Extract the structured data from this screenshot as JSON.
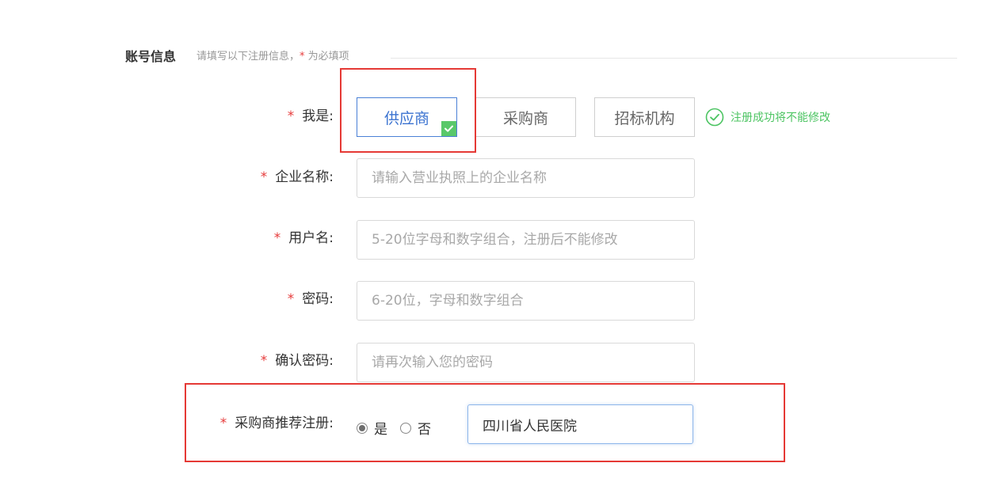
{
  "section": {
    "title": "账号信息",
    "hint_prefix": "请填写以下注册信息，",
    "hint_star": "*",
    "hint_suffix": " 为必填项"
  },
  "required_mark": "*",
  "role": {
    "label": "我是:",
    "options": [
      "供应商",
      "采购商",
      "招标机构"
    ],
    "selected": "供应商",
    "notice": "注册成功将不能修改"
  },
  "company": {
    "label": "企业名称:",
    "placeholder": "请输入营业执照上的企业名称",
    "value": ""
  },
  "username": {
    "label": "用户名:",
    "placeholder": "5-20位字母和数字组合，注册后不能修改",
    "value": ""
  },
  "password": {
    "label": "密码:",
    "placeholder": "6-20位，字母和数字组合",
    "value": ""
  },
  "confirm_password": {
    "label": "确认密码:",
    "placeholder": "请再次输入您的密码",
    "value": ""
  },
  "referral": {
    "label": "采购商推荐注册:",
    "yes_label": "是",
    "no_label": "否",
    "selected": "是",
    "value": "四川省人民医院"
  },
  "colors": {
    "required": "#e63b3b",
    "active_border": "#4a80d6",
    "success": "#4cc462",
    "highlight": "#e53935"
  }
}
